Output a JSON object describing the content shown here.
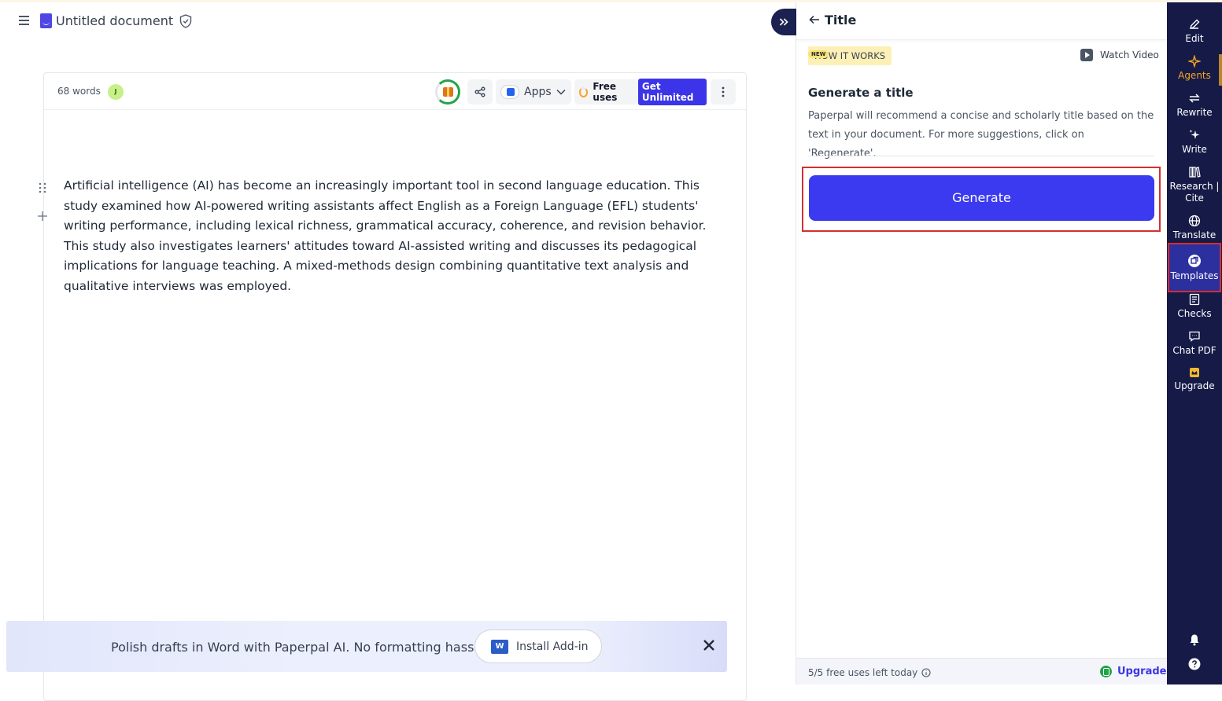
{
  "header": {
    "doc_title": "Untitled document"
  },
  "editor": {
    "word_count": "68 words",
    "avatar_initial": "J",
    "apps_label": "Apps",
    "free_uses_label": "Free uses",
    "get_unlimited_label": "Get Unlimited",
    "body_text": "Artificial intelligence (AI) has become an increasingly important tool in second language education. This study examined how AI-powered writing assistants affect English as a Foreign Language (EFL) students' writing performance, including lexical richness, grammatical accuracy, coherence, and revision behavior. This study also investigates learners' attitudes toward AI-assisted writing and discusses its pedagogical implications for language teaching. A mixed-methods design combining quantitative text analysis and qualitative interviews was employed."
  },
  "banner": {
    "text": "Polish drafts in Word with Paperpal AI. No formatting hassles.",
    "install_label": "Install Add-in",
    "word_logo": "W"
  },
  "panel": {
    "title": "Title",
    "how_it_works": "HOW IT WORKS",
    "watch_video": "Watch Video",
    "new_badge": "NEW",
    "heading": "Generate a title",
    "description": "Paperpal will recommend a concise and scholarly title based on the text in your document. For more suggestions, click on 'Regenerate'.",
    "generate_label": "Generate",
    "free_uses_left": "5/5 free uses left today",
    "upgrade_label": "Upgrade"
  },
  "rail": {
    "items": [
      {
        "label": "Edit",
        "icon": "pen-icon"
      },
      {
        "label": "Agents",
        "icon": "sparkle-icon"
      },
      {
        "label": "Rewrite",
        "icon": "rewrite-icon"
      },
      {
        "label": "Write",
        "icon": "write-sparkle-icon"
      },
      {
        "label": "Research | Cite",
        "icon": "books-icon"
      },
      {
        "label": "Translate",
        "icon": "globe-icon"
      },
      {
        "label": "Templates",
        "icon": "templates-icon"
      },
      {
        "label": "Checks",
        "icon": "checklist-icon"
      },
      {
        "label": "Chat PDF",
        "icon": "chat-icon"
      },
      {
        "label": "Upgrade",
        "icon": "crown-icon"
      }
    ]
  },
  "colors": {
    "accent": "#3b3af0",
    "rail_bg": "#161a47",
    "highlight": "#d32f2f",
    "agents": "#f5a623"
  }
}
